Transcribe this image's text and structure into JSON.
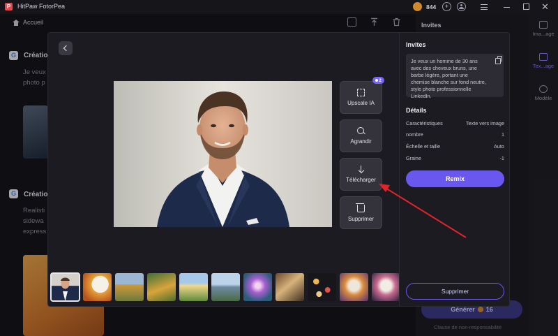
{
  "app": {
    "title": "HitPaw FotorPea",
    "credits": "844"
  },
  "nav": {
    "home_label": "Accueil"
  },
  "background": {
    "card1_title": "Créatio",
    "card1_text": [
      "Je veux",
      "photo p"
    ],
    "card2_title": "Créatio",
    "card2_text": [
      "Realisti",
      "sidewa",
      "express"
    ],
    "right_panel_title": "Invites",
    "side_items": [
      "Ima...age",
      "Tex...age",
      "Modèle"
    ],
    "generate_label": "Générer",
    "generate_cost": "16",
    "disclaimer": "Clause de non-responsabilité"
  },
  "modal": {
    "actions": {
      "upscale_label": "Upscale IA",
      "upscale_badge": "2",
      "zoom_label": "Agrandir",
      "download_label": "Télécharger",
      "delete_label": "Supprimer"
    },
    "details": {
      "prompts_title": "Invites",
      "prompt_text": "Je veux un homme de 30 ans avec des cheveux bruns, une barbe légère, portant une chemise blanche sur fond neutre, style photo professionnelle LinkedIn.",
      "details_title": "Détails",
      "rows": [
        {
          "label": "Caractéristiques",
          "value": "Texte vers image"
        },
        {
          "label": "nombre",
          "value": "1"
        },
        {
          "label": "Échelle et taille",
          "value": "Auto"
        },
        {
          "label": "Graine",
          "value": "-1"
        }
      ],
      "remix_label": "Remix",
      "delete_label": "Supprimer"
    }
  },
  "colors": {
    "accent": "#6a57ef",
    "arrow": "#e0242b"
  }
}
